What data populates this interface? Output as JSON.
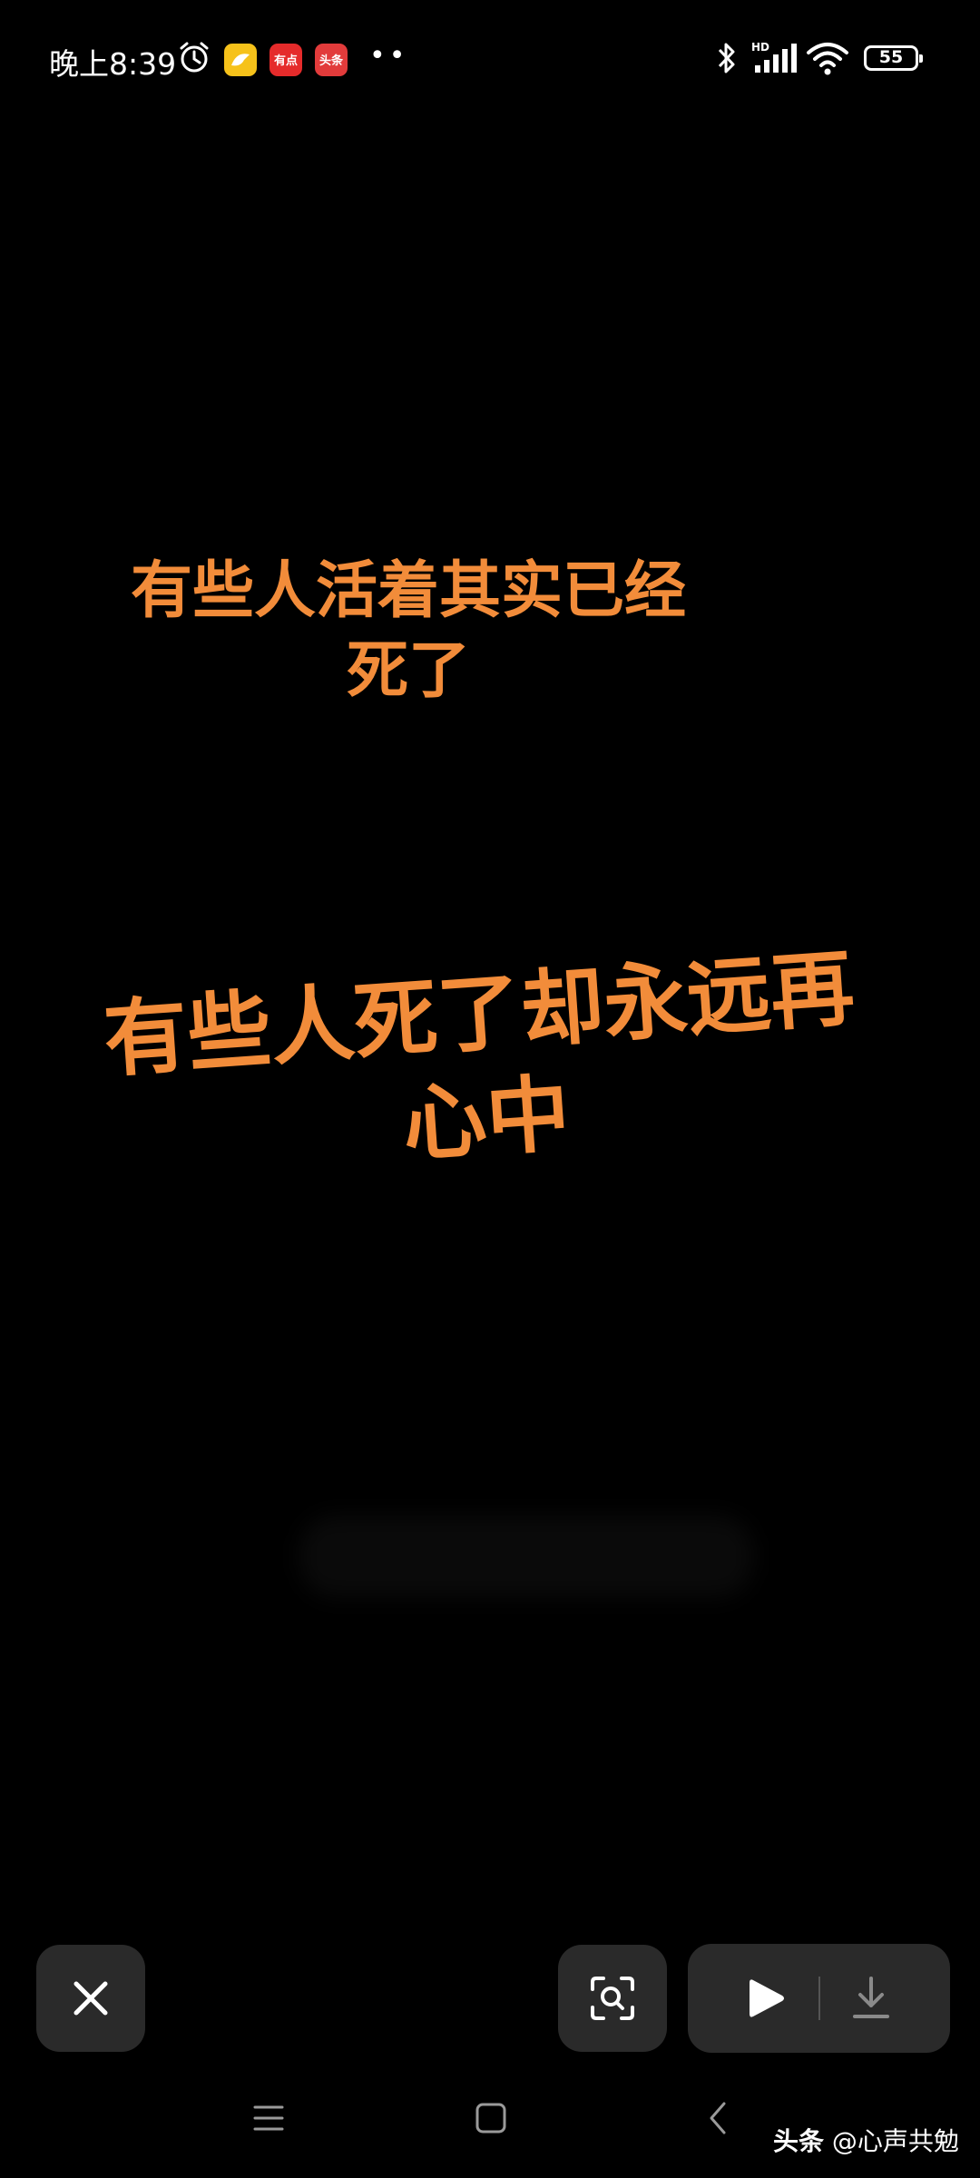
{
  "status_bar": {
    "time": "晚上8:39",
    "notification_apps": [
      "app-icon-1",
      "有点",
      "头条"
    ],
    "battery_level": "55",
    "signal_label": "HD"
  },
  "content": {
    "caption_top": "有些人活着其实已经\n死了",
    "caption_main": "有些人死了却永远再\n心中",
    "caption_color": "#f28c3a"
  },
  "controls": {
    "close": "close-icon",
    "lens": "scan-search-icon",
    "play": "play-icon",
    "download": "download-icon"
  },
  "nav": {
    "menu": "menu-icon",
    "home": "home-icon",
    "back": "back-icon"
  },
  "watermark": {
    "brand": "头条",
    "handle": "@心声共勉"
  }
}
